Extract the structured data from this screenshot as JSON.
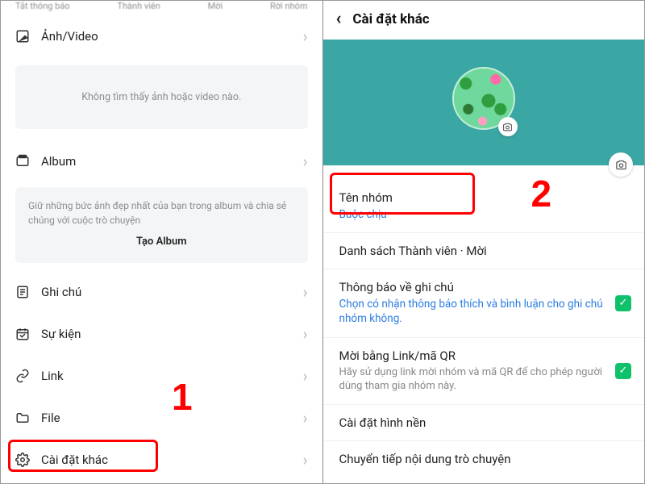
{
  "left": {
    "topbar": [
      "Tắt thông báo",
      "Thành viên",
      "Mời",
      "Rời nhóm"
    ],
    "photo_section": "Ảnh/Video",
    "photo_empty": "Không tìm thấy ảnh hoặc video nào.",
    "album_section": "Album",
    "album_desc": "Giữ những bức ảnh đẹp nhất của bạn trong album và chia sẻ chúng với cuộc trò chuyện",
    "album_create": "Tạo Album",
    "rows": {
      "notes": "Ghi chú",
      "events": "Sự kiện",
      "link": "Link",
      "file": "File",
      "other": "Cài đặt khác"
    },
    "step_number": "1"
  },
  "right": {
    "header": "Cài đặt khác",
    "group_name_label": "Tên nhóm",
    "group_name_value": "Buộc chịu",
    "members": "Danh sách Thành viên · Mời",
    "notif_title": "Thông báo về ghi chú",
    "notif_desc": "Chọn có nhận thông báo thích và bình luận cho ghi chú nhóm không.",
    "qr_title": "Mời bằng Link/mã QR",
    "qr_desc": "Hãy sử dụng link mời nhóm và mã QR để cho phép người dùng tham gia nhóm này.",
    "wallpaper": "Cài đặt hình nền",
    "forward": "Chuyển tiếp nội dung trò chuyện",
    "step_number": "2"
  }
}
